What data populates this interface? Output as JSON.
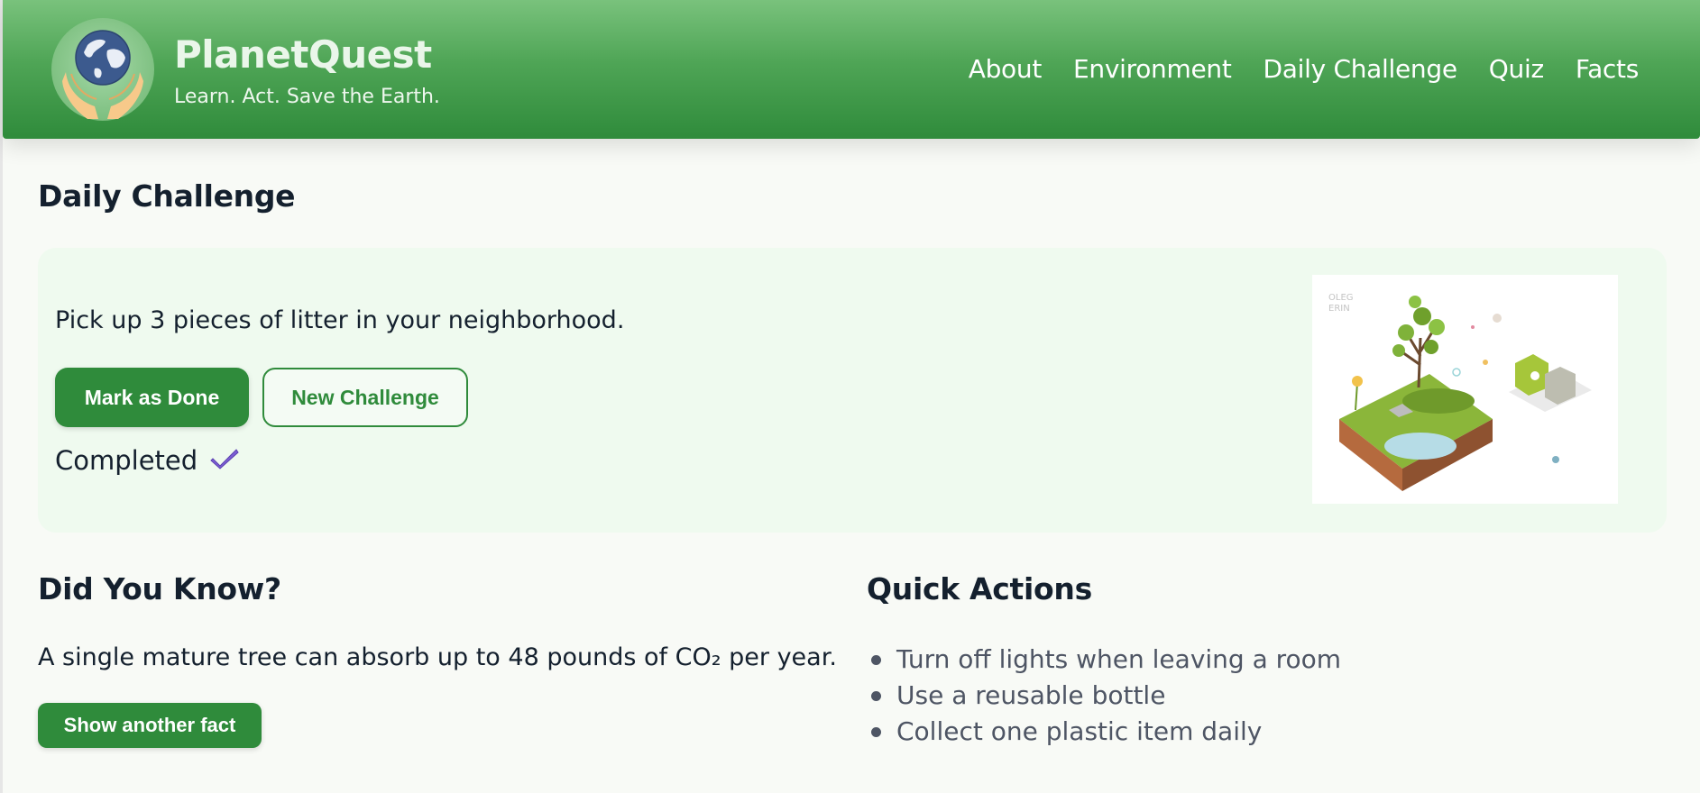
{
  "brand": {
    "title": "PlanetQuest",
    "tagline": "Learn. Act. Save the Earth."
  },
  "nav": {
    "items": [
      "About",
      "Environment",
      "Daily Challenge",
      "Quiz",
      "Facts"
    ]
  },
  "daily_challenge": {
    "title": "Daily Challenge",
    "text": "Pick up 3 pieces of litter in your neighborhood.",
    "mark_done_label": "Mark as Done",
    "new_challenge_label": "New Challenge",
    "status": "Completed",
    "status_icon": "check-icon",
    "illustration_text": "OLEG\nERIN"
  },
  "did_you_know": {
    "title": "Did You Know?",
    "fact": "A single mature tree can absorb up to 48 pounds of CO₂ per year.",
    "button_label": "Show another fact"
  },
  "quick_actions": {
    "title": "Quick Actions",
    "items": [
      "Turn off lights when leaving a room",
      "Use a reusable bottle",
      "Collect one plastic item daily"
    ]
  },
  "colors": {
    "primary": "#2f8b3b",
    "header_top": "#79c27c",
    "card_bg": "#effaef",
    "check": "#7d5fd4"
  }
}
